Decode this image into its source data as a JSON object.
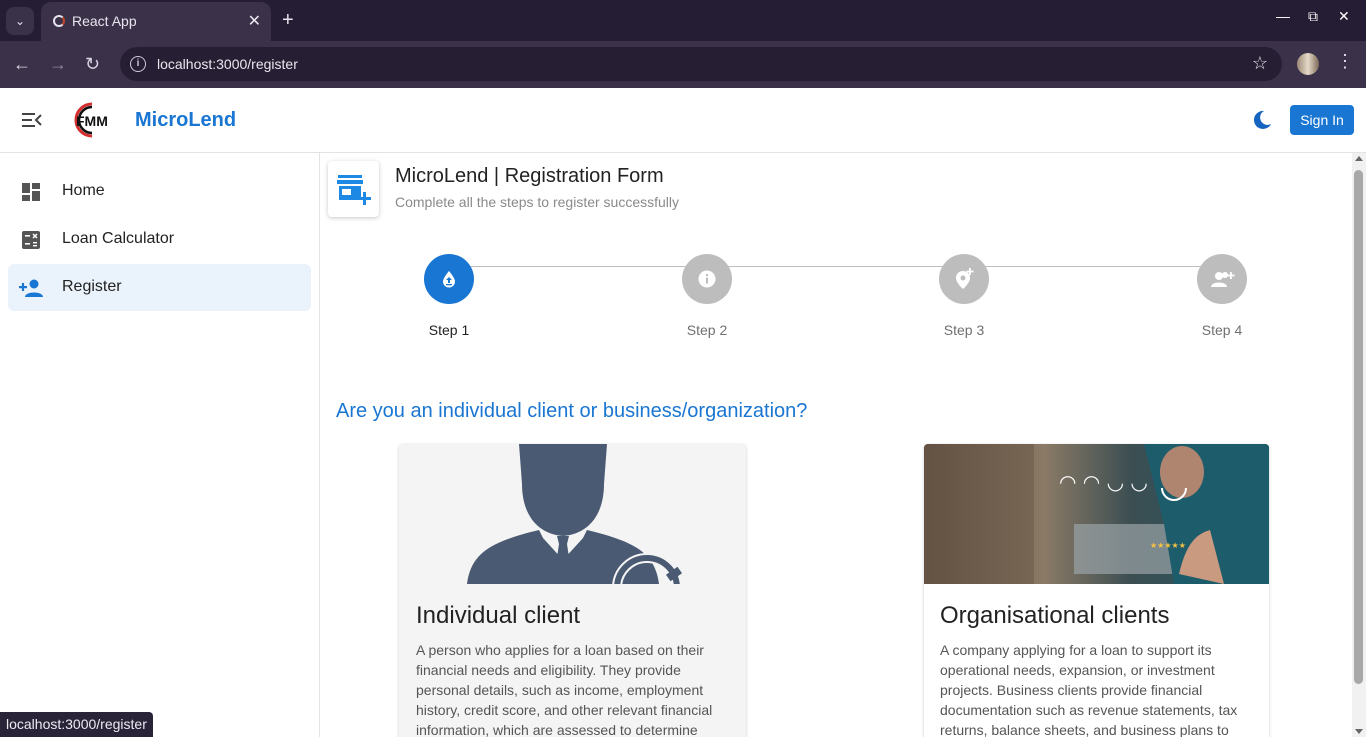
{
  "browser": {
    "tab_title": "React App",
    "url": "localhost:3000/register",
    "status_url": "localhost:3000/register"
  },
  "header": {
    "brand": "MicroLend",
    "logo_text": "FMM",
    "signin_label": "Sign In"
  },
  "sidebar": {
    "items": [
      {
        "label": "Home",
        "icon": "dashboard-icon"
      },
      {
        "label": "Loan Calculator",
        "icon": "calculator-icon"
      },
      {
        "label": "Register",
        "icon": "person-add-icon",
        "active": true
      }
    ]
  },
  "form": {
    "title": "MicroLend | Registration Form",
    "subtitle": "Complete all the steps to register successfully"
  },
  "stepper": {
    "steps": [
      {
        "label": "Step 1",
        "icon": "upload-drop-icon",
        "active": true
      },
      {
        "label": "Step 2",
        "icon": "info-icon",
        "active": false
      },
      {
        "label": "Step 3",
        "icon": "location-add-icon",
        "active": false
      },
      {
        "label": "Step 4",
        "icon": "group-add-icon",
        "active": false
      }
    ]
  },
  "question": "Are you an individual client or business/organization?",
  "cards": {
    "individual": {
      "title": "Individual client",
      "description": "A person who applies for a loan based on their financial needs and eligibility. They provide personal details, such as income, employment history, credit score, and other relevant financial information, which are assessed to determine"
    },
    "organisational": {
      "title": "Organisational clients",
      "description": "A company applying for a loan to support its operational needs, expansion, or investment projects. Business clients provide financial documentation such as revenue statements, tax returns, balance sheets, and business plans to"
    }
  },
  "colors": {
    "primary": "#1976d2",
    "step_inactive": "#bdbdbd",
    "browser_dark": "#241d33"
  }
}
